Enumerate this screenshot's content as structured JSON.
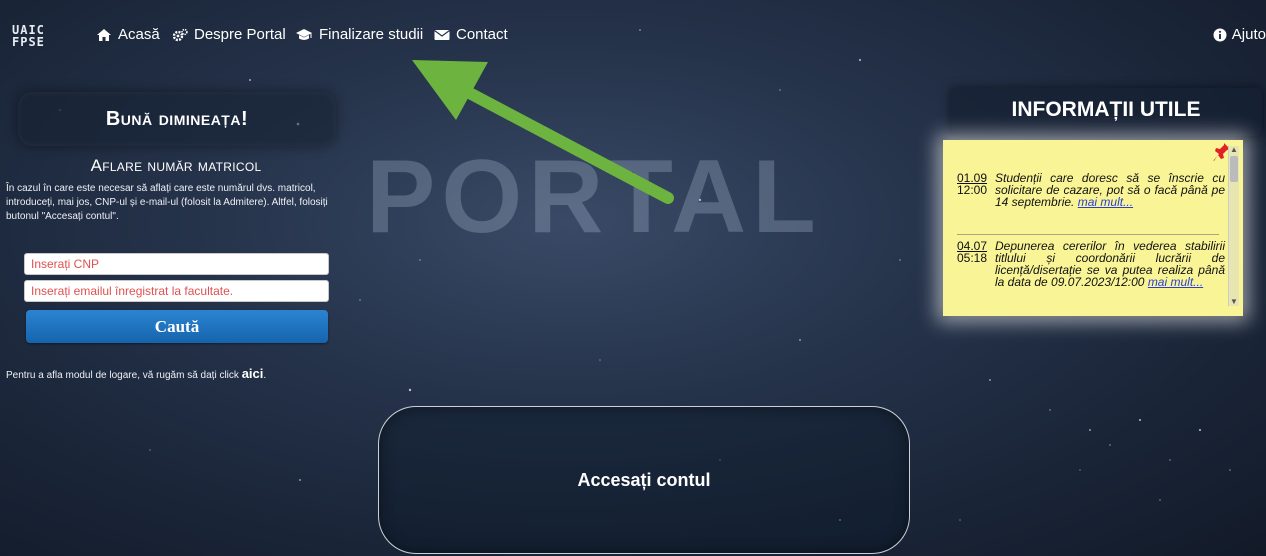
{
  "nav": {
    "logo_lines": [
      "UAIC",
      "FPSE"
    ],
    "items": [
      {
        "label": "Acasă",
        "icon": "home-icon"
      },
      {
        "label": "Despre Portal",
        "icon": "gears-icon"
      },
      {
        "label": "Finalizare studii",
        "icon": "graduation-cap-icon"
      },
      {
        "label": "Contact",
        "icon": "envelope-icon"
      }
    ],
    "help_label": "Ajuto"
  },
  "left": {
    "greeting": "Bună dimineața!",
    "matricol_title": "Aflare număr matricol",
    "matricol_desc": "În cazul în care este necesar să aflați care este numărul dvs. matricol, introduceți, mai jos, CNP-ul și e-mail-ul (folosit la Admitere). Altfel, folosiți butonul \"Accesați contul\".",
    "cnp_placeholder": "Inserați CNP",
    "email_placeholder": "Inserați emailul înregistrat la facultate.",
    "search_label": "Caută",
    "login_info_prefix": "Pentru a afla modul de logare, vă rugăm să dați click ",
    "login_info_link": "aici",
    "login_info_suffix": "."
  },
  "watermark": "PORTAL",
  "access_label": "Accesați contul",
  "info": {
    "title": "INFORMAȚII UTILE",
    "news": [
      {
        "date": "01.09",
        "time": "12:00",
        "text": "Studenții care doresc să se înscrie cu solicitare de cazare, pot să o facă până pe 14 septembrie.",
        "more": "mai mult..."
      },
      {
        "date": "04.07",
        "time": "05:18",
        "text": "Depunerea cererilor în vederea stabilirii titlului și coordonării lucrării de licență/disertație se va putea realiza până la data de 09.07.2023/12:00",
        "more": "mai mult..."
      }
    ]
  },
  "colors": {
    "accent_arrow": "#6db33f",
    "button_blue": "#1f74c2",
    "note_yellow": "#f9f596"
  }
}
